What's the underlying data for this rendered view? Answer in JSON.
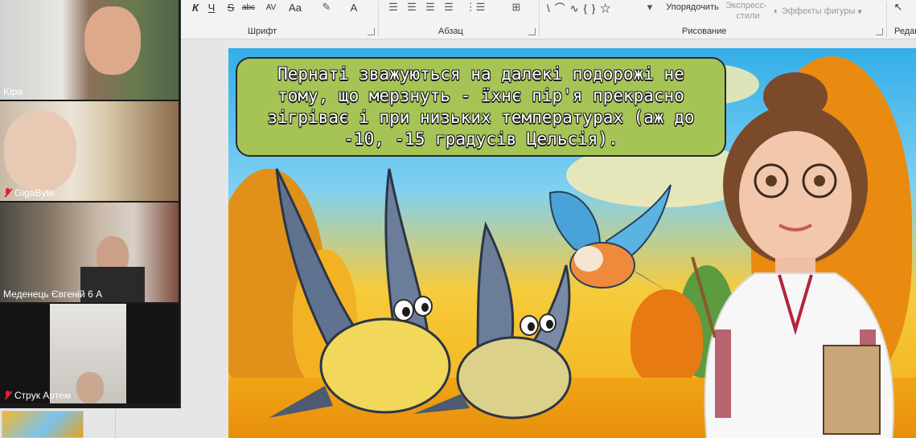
{
  "ribbon": {
    "groups": {
      "font": "Шрифт",
      "paragraph": "Абзац",
      "drawing": "Рисование",
      "editing": "Редак"
    },
    "font_tools": [
      "К",
      "Ч",
      "S",
      "abc",
      "AV",
      "Aa",
      "A"
    ],
    "arrange_label": "Упорядочить",
    "quick_styles_label": "Экспресс-\nстили",
    "quick_styles_line1": "Экспресс-",
    "quick_styles_line2": "стили",
    "shape_effects_label": "Эффекты фигуры"
  },
  "slide": {
    "text": "Пернаті зважуються на далекі подорожі не тому, що мерзнуть - їхнє пір'я прекрасно зігріває і при низьких температурах (аж до -10, -15 градусів Цельсія).",
    "colors": {
      "textbox_fill": "#a6c455",
      "sky": "#34aee8",
      "autumn": "#f2ad16"
    }
  },
  "participants": [
    {
      "name": "Kipa",
      "muted": false
    },
    {
      "name": "GigaByte",
      "muted": true
    },
    {
      "name": "Меденець Євгеній 6 А",
      "muted": false
    },
    {
      "name": "Струк Артем",
      "muted": true
    }
  ]
}
